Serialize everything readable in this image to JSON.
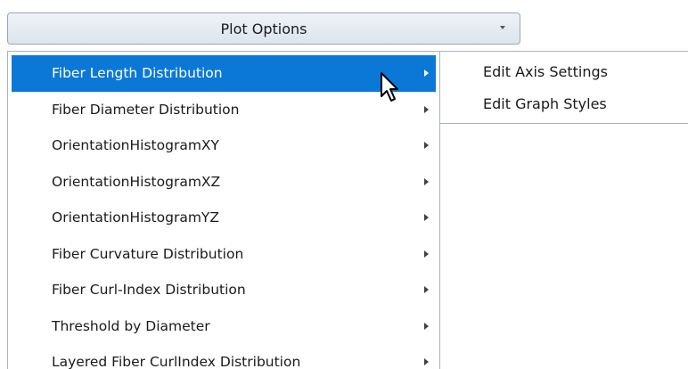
{
  "dropdown": {
    "label": "Plot Options",
    "arrow_icon": "chevron-down-icon"
  },
  "menu": {
    "items": [
      {
        "label": "Fiber Length Distribution",
        "active": true
      },
      {
        "label": "Fiber Diameter Distribution",
        "active": false
      },
      {
        "label": "OrientationHistogramXY",
        "active": false
      },
      {
        "label": "OrientationHistogramXZ",
        "active": false
      },
      {
        "label": "OrientationHistogramYZ",
        "active": false
      },
      {
        "label": "Fiber Curvature Distribution",
        "active": false
      },
      {
        "label": "Fiber Curl-Index Distribution",
        "active": false
      },
      {
        "label": "Threshold by Diameter",
        "active": false
      },
      {
        "label": "Layered Fiber CurlIndex Distribution",
        "active": false
      }
    ]
  },
  "submenu": {
    "items": [
      {
        "label": "Edit Axis Settings"
      },
      {
        "label": "Edit Graph Styles"
      }
    ]
  },
  "colors": {
    "highlight": "#0b78d7",
    "text": "#1a1a1a",
    "border": "#a9b3bf"
  }
}
